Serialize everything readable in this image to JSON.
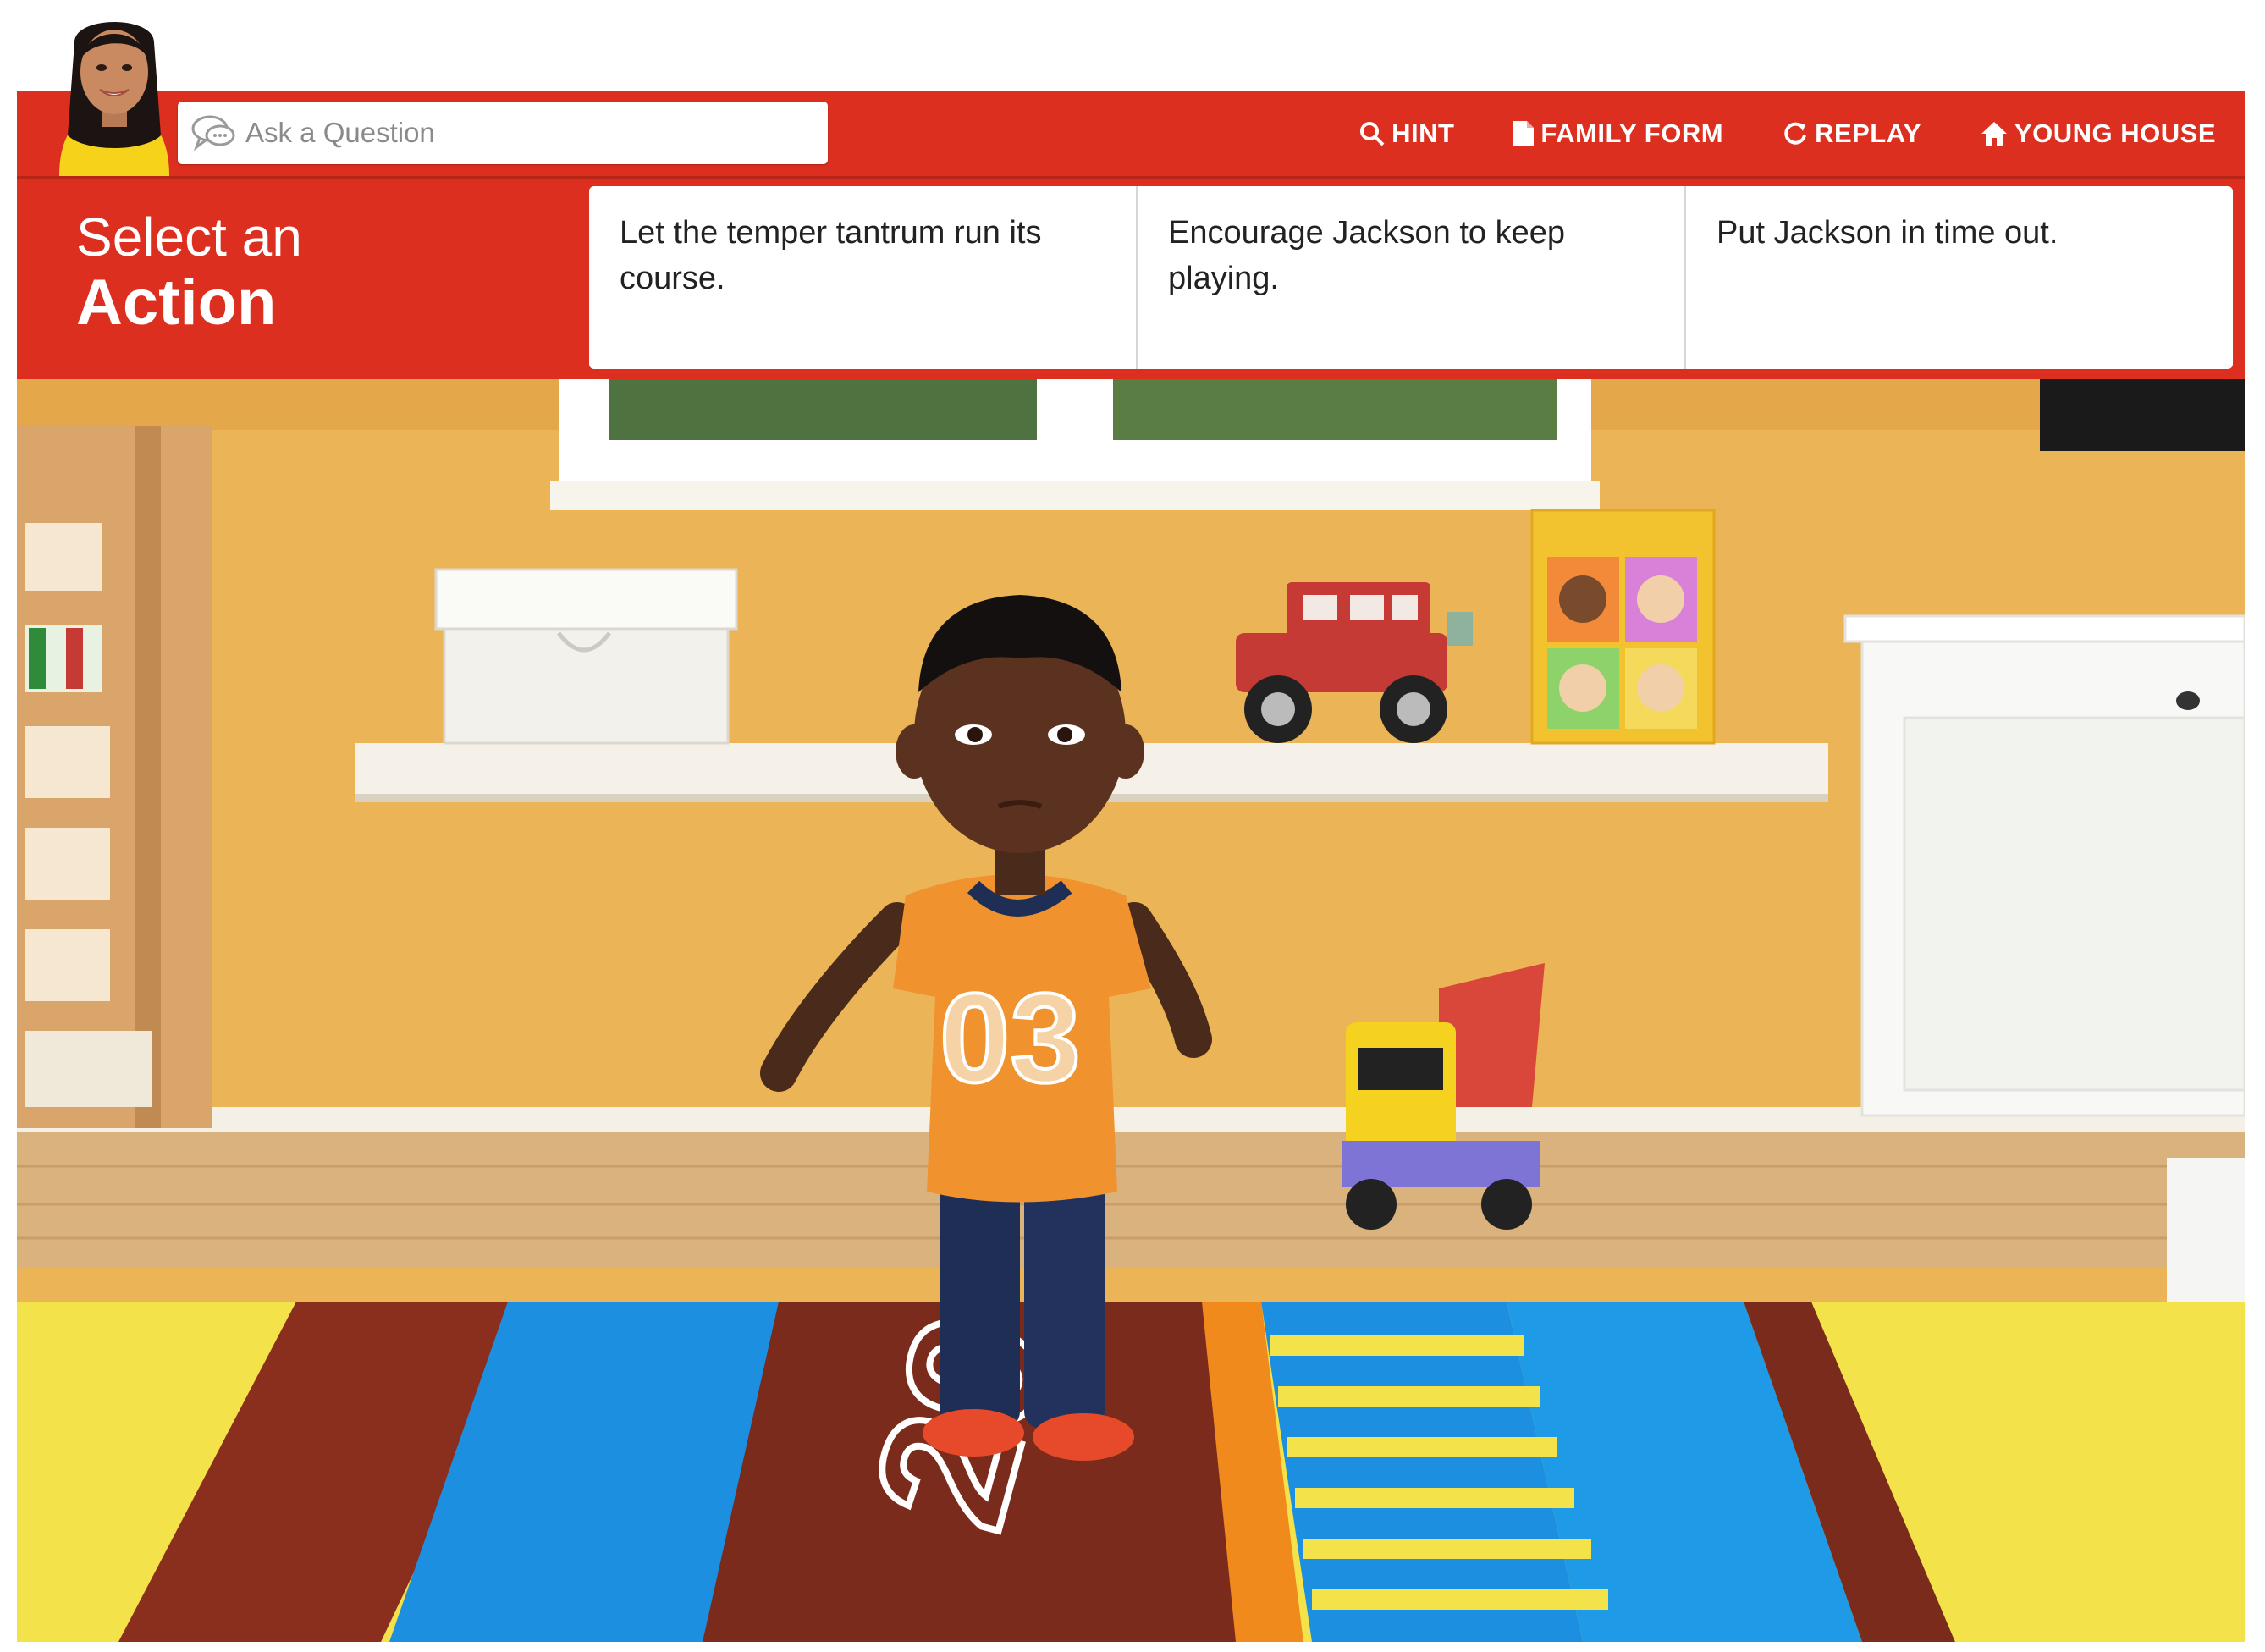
{
  "search": {
    "placeholder": "Ask a Question"
  },
  "toolbar": {
    "hint": "HINT",
    "family_form": "FAMILY FORM",
    "replay": "REPLAY",
    "young_house": "YOUNG HOUSE"
  },
  "action_panel": {
    "title_line1": "Select an",
    "title_line2": "Action",
    "choices": [
      "Let the temper tantrum run its course.",
      "Encourage Jackson to keep playing.",
      "Put Jackson in time out."
    ]
  },
  "scene": {
    "shirt_number": "03",
    "rug_number": "29"
  },
  "colors": {
    "brand_red": "#dc2f1f",
    "wall": "#eab457",
    "shirt": "#f0932f"
  }
}
